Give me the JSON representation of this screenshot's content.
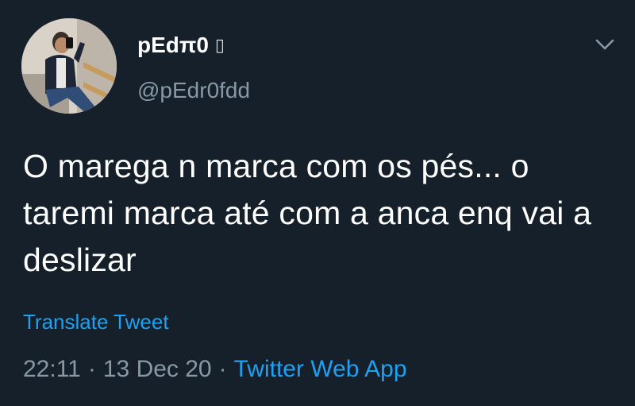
{
  "tweet": {
    "display_name": "pEdπ0",
    "name_emoji": "▯",
    "handle": "@pEdr0fdd",
    "text": "O marega n marca com os pés... o taremi marca até com a anca enq vai a deslizar",
    "translate_label": "Translate Tweet",
    "time": "22:11",
    "date": "13 Dec 20",
    "separator": "·",
    "source": "Twitter Web App"
  },
  "icons": {
    "avatar": "profile-photo",
    "more": "chevron-down-icon"
  },
  "colors": {
    "background": "#15202b",
    "primary_text": "#ffffff",
    "secondary_text": "#8899a6",
    "accent": "#1da1f2"
  }
}
